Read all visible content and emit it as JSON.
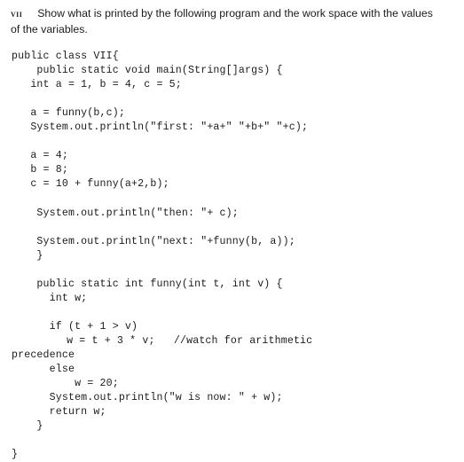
{
  "document": {
    "type": "exercise-question",
    "background_color": "#ffffff",
    "text_color": "#1b1b1b"
  },
  "question": {
    "number": "VII",
    "prompt": "Show what is printed by the following program and the work space with the values of the variables."
  },
  "code": {
    "language": "java",
    "class_name": "VII",
    "lines": [
      "public class VII{",
      "    public static void main(String[]args) {",
      "   int a = 1, b = 4, c = 5;",
      "",
      "   a = funny(b,c);",
      "   System.out.println(\"first: \"+a+\" \"+b+\" \"+c);",
      "",
      "   a = 4;",
      "   b = 8;",
      "   c = 10 + funny(a+2,b);",
      "",
      "    System.out.println(\"then: \"+ c);",
      "",
      "    System.out.println(\"next: \"+funny(b, a));",
      "    }",
      "",
      "    public static int funny(int t, int v) {",
      "      int w;",
      "",
      "      if (t + 1 > v)",
      "          w = t + 3 * v;   //watch for arithmetic",
      "precedence",
      "      else",
      "          w = 20;",
      "      System.out.println(\"w is now: \" + w);",
      "      return w;",
      "    }",
      "",
      "}"
    ],
    "wrapped_line_indices": [
      20
    ]
  }
}
